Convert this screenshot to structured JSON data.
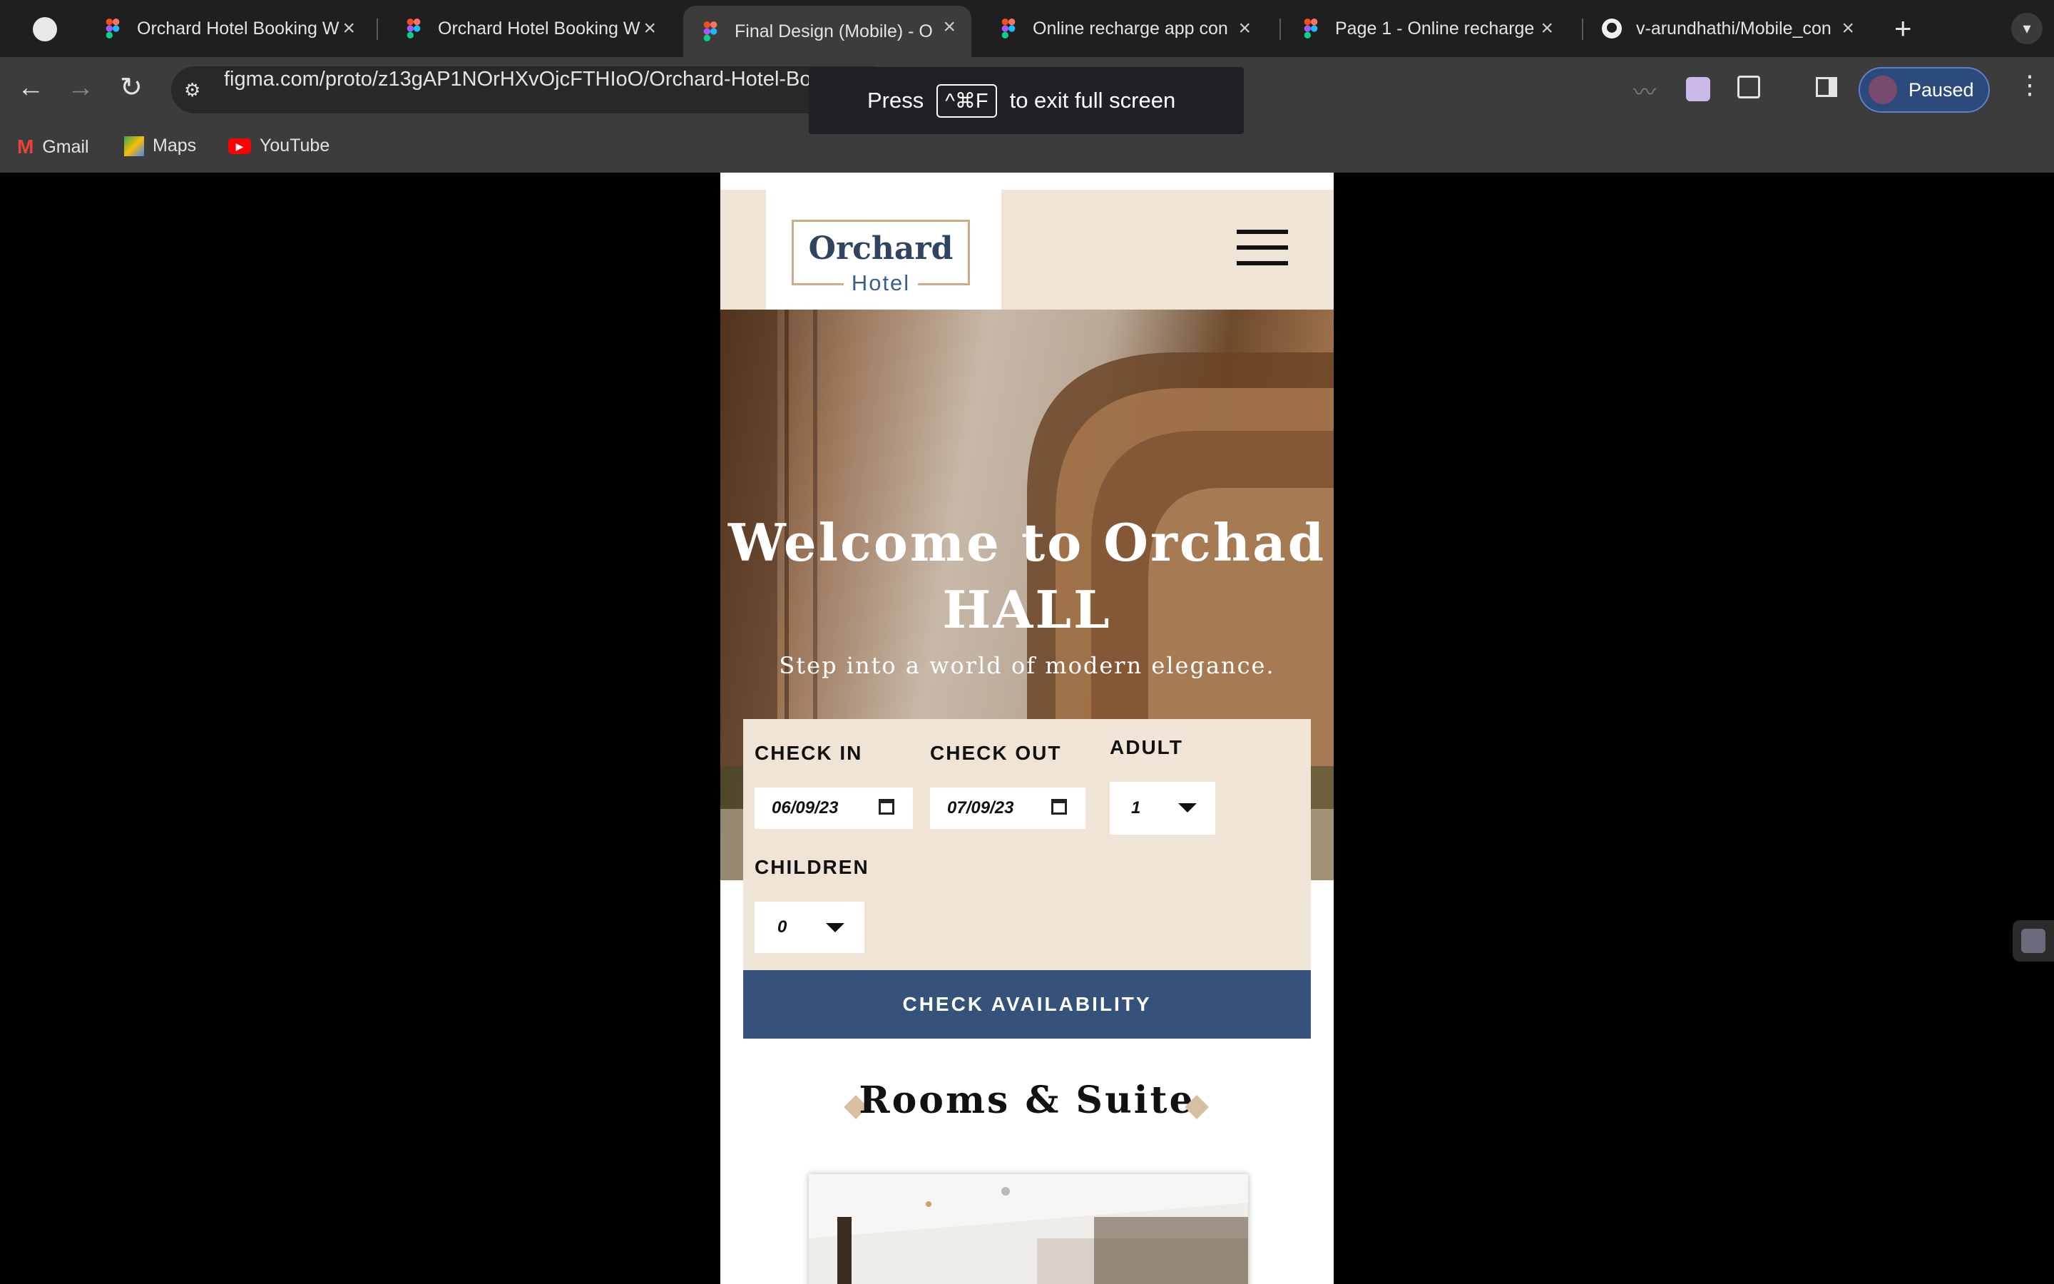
{
  "browser": {
    "tabs": [
      {
        "title": "Orchard Hotel Booking W",
        "active": false
      },
      {
        "title": "Orchard Hotel Booking W",
        "active": false
      },
      {
        "title": "Final Design (Mobile) - O",
        "active": true
      },
      {
        "title": "Online recharge app con",
        "active": false
      },
      {
        "title": "Page 1 - Online recharge",
        "active": false
      },
      {
        "title": "v-arundhathi/Mobile_con",
        "active": false
      }
    ],
    "url": "figma.com/proto/z13gAP1NOrHXvOjcFTHIoO/Orchard-Hotel-Booking-Website-(Community)?type=design&node-id=260-2790&t=Th2icUO...",
    "fullscreen_notice": {
      "press": "Press",
      "key": "^⌘F",
      "rest": "to exit full screen"
    },
    "profile": "Paused",
    "bookmarks": [
      "Gmail",
      "Maps",
      "YouTube"
    ]
  },
  "site": {
    "logo_main": "Orchard",
    "logo_sub": "Hotel",
    "hero_title_line1": "Welcome to Orchad",
    "hero_title_line2": "HALL",
    "hero_subtitle": "Step into a world of modern elegance.",
    "form": {
      "checkin_label": "CHECK IN",
      "checkin_value": "06/09/23",
      "checkout_label": "CHECK OUT",
      "checkout_value": "07/09/23",
      "adult_label": "ADULT",
      "adult_value": "1",
      "children_label": "CHILDREN",
      "children_value": "0"
    },
    "cta": "CHECK AVAILABILITY",
    "section_title": "Rooms & Suite"
  },
  "colors": {
    "navy": "#34527a",
    "beige": "#efe4d6",
    "accent": "#d7bfa1"
  }
}
